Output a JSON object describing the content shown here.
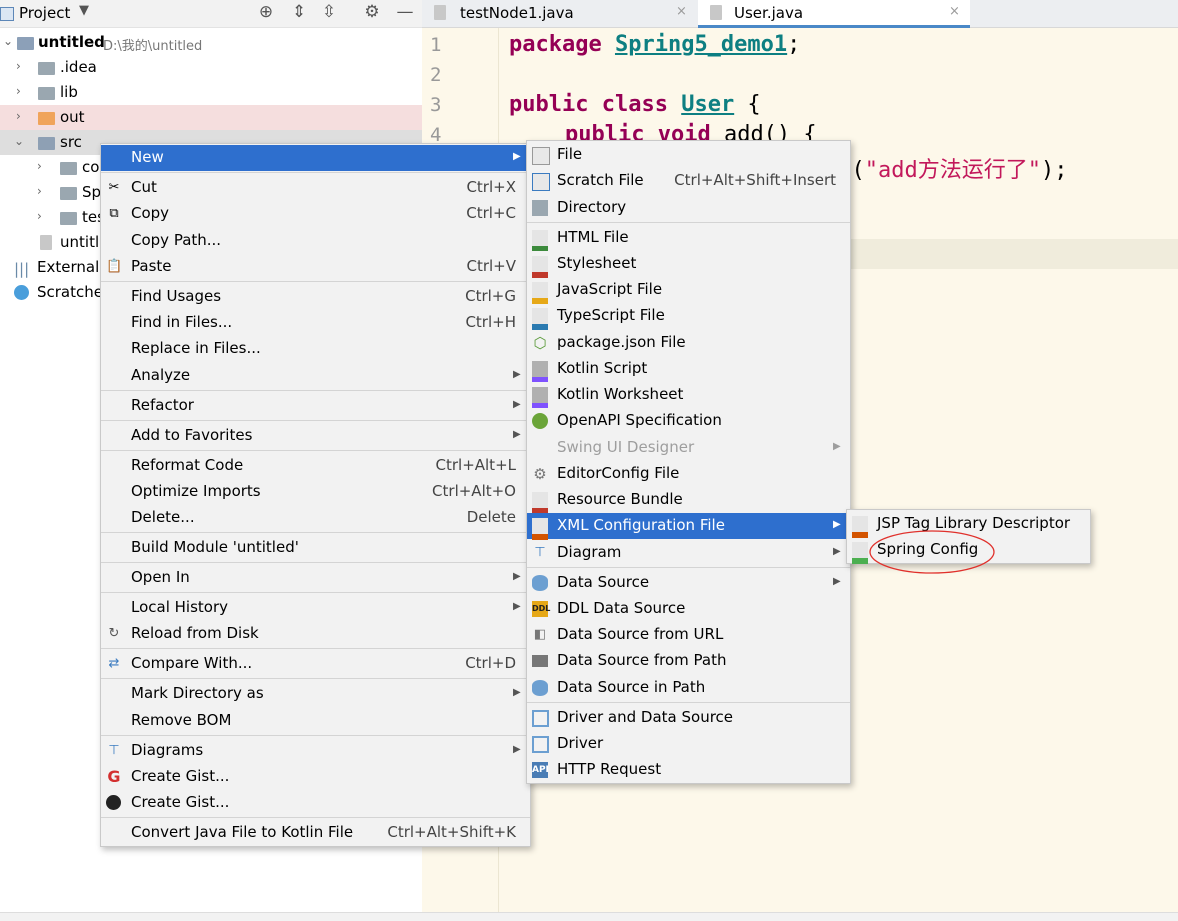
{
  "project_panel": {
    "title": "Project",
    "toolbar_icons": [
      "target-icon",
      "expand-all-icon",
      "collapse-all-icon",
      "gear-icon",
      "minimize-icon"
    ],
    "tree": [
      {
        "label": "untitled",
        "path": "D:\\我的\\untitled"
      },
      {
        "label": ".idea"
      },
      {
        "label": "lib"
      },
      {
        "label": "out"
      },
      {
        "label": "src"
      },
      {
        "label": "co"
      },
      {
        "label": "Sp"
      },
      {
        "label": "tes"
      },
      {
        "label": "untitl"
      },
      {
        "label": "External"
      },
      {
        "label": "Scratche"
      }
    ]
  },
  "editor": {
    "tabs": [
      {
        "label": "testNode1.java",
        "close": "×"
      },
      {
        "label": "User.java",
        "close": "×"
      }
    ],
    "line_numbers": [
      "1",
      "2",
      "3",
      "4"
    ],
    "code": {
      "line1_kw": "package",
      "line1_pkg": "Spring5_demo1",
      "line1_end": ";",
      "line3_kw": "public class",
      "line3_cls": "User",
      "line3_end": " {",
      "line4_kw": "public void",
      "line4_rest": " add() {",
      "line5_pre": "ln(",
      "line5_str": "\"add方法运行了\"",
      "line5_end": ");"
    }
  },
  "context_menu": {
    "items": [
      {
        "label": "New",
        "submenu": true
      },
      {
        "label": "Cut",
        "shortcut": "Ctrl+X",
        "icon": "scissors-icon"
      },
      {
        "label": "Copy",
        "shortcut": "Ctrl+C",
        "icon": "copy-icon"
      },
      {
        "label": "Copy Path...",
        "shortcut": ""
      },
      {
        "label": "Paste",
        "shortcut": "Ctrl+V",
        "icon": "paste-icon"
      },
      {
        "label": "Find Usages",
        "shortcut": "Ctrl+G"
      },
      {
        "label": "Find in Files...",
        "shortcut": "Ctrl+H"
      },
      {
        "label": "Replace in Files...",
        "shortcut": ""
      },
      {
        "label": "Analyze",
        "submenu": true
      },
      {
        "label": "Refactor",
        "submenu": true
      },
      {
        "label": "Add to Favorites",
        "submenu": true
      },
      {
        "label": "Reformat Code",
        "shortcut": "Ctrl+Alt+L"
      },
      {
        "label": "Optimize Imports",
        "shortcut": "Ctrl+Alt+O"
      },
      {
        "label": "Delete...",
        "shortcut": "Delete"
      },
      {
        "label": "Build Module 'untitled'",
        "shortcut": ""
      },
      {
        "label": "Open In",
        "submenu": true
      },
      {
        "label": "Local History",
        "submenu": true
      },
      {
        "label": "Reload from Disk",
        "shortcut": "",
        "icon": "reload-icon"
      },
      {
        "label": "Compare With...",
        "shortcut": "Ctrl+D",
        "icon": "compare-icon"
      },
      {
        "label": "Mark Directory as",
        "submenu": true
      },
      {
        "label": "Remove BOM",
        "shortcut": ""
      },
      {
        "label": "Diagrams",
        "submenu": true,
        "icon": "diagram-icon"
      },
      {
        "label": "Create Gist...",
        "icon": "gitee-icon"
      },
      {
        "label": "Create Gist...",
        "icon": "github-icon"
      },
      {
        "label": "Convert Java File to Kotlin File",
        "shortcut": "Ctrl+Alt+Shift+K"
      }
    ]
  },
  "new_submenu": {
    "items": [
      {
        "label": "File"
      },
      {
        "label": "Scratch File",
        "shortcut": "Ctrl+Alt+Shift+Insert"
      },
      {
        "label": "Directory"
      },
      {
        "label": "HTML File",
        "icon_text": "H"
      },
      {
        "label": "Stylesheet",
        "icon_text": "CSS"
      },
      {
        "label": "JavaScript File",
        "icon_text": "JS"
      },
      {
        "label": "TypeScript File",
        "icon_text": "TS"
      },
      {
        "label": "package.json File",
        "icon_text": "⬡"
      },
      {
        "label": "Kotlin Script"
      },
      {
        "label": "Kotlin Worksheet"
      },
      {
        "label": "OpenAPI Specification"
      },
      {
        "label": "Swing UI Designer",
        "disabled": true,
        "submenu": true
      },
      {
        "label": "EditorConfig File",
        "icon_text": "⚙"
      },
      {
        "label": "Resource Bundle"
      },
      {
        "label": "XML Configuration File",
        "submenu": true,
        "selected": true
      },
      {
        "label": "Diagram",
        "submenu": true
      },
      {
        "label": "Data Source",
        "submenu": true
      },
      {
        "label": "DDL Data Source",
        "icon_text": "DDL"
      },
      {
        "label": "Data Source from URL"
      },
      {
        "label": "Data Source from Path"
      },
      {
        "label": "Data Source in Path"
      },
      {
        "label": "Driver and Data Source"
      },
      {
        "label": "Driver"
      },
      {
        "label": "HTTP Request",
        "icon_text": "API"
      }
    ]
  },
  "xml_submenu": {
    "items": [
      {
        "label": "JSP Tag Library Descriptor"
      },
      {
        "label": "Spring Config"
      }
    ],
    "annotation_color": "#e0302b"
  },
  "colors": {
    "selection": "#2e6fce",
    "menu_bg": "#f2f2f2",
    "editor_bg": "#fdf8ea",
    "out_folder_row": "#f5dede",
    "src_folder_row": "#dedede"
  }
}
